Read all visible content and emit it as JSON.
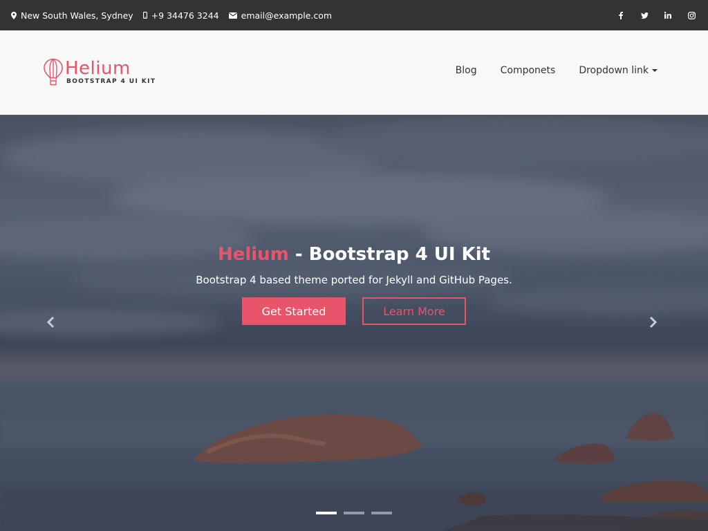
{
  "topbar": {
    "location": "New South Wales, Sydney",
    "phone": "+9 34476 3244",
    "email": "email@example.com",
    "social": [
      "facebook-icon",
      "twitter-icon",
      "linkedin-icon",
      "instagram-icon"
    ]
  },
  "brand": {
    "name": "Helium",
    "tagline": "BOOTSTRAP 4 UI KIT",
    "color": "#e8556a"
  },
  "nav": {
    "items": [
      {
        "label": "Blog"
      },
      {
        "label": "Componets"
      },
      {
        "label": "Dropdown link"
      }
    ]
  },
  "hero": {
    "title_accent": "Helium",
    "title_rest": " - Bootstrap 4 UI Kit",
    "subtitle": "Bootstrap 4 based theme ported for Jekyll and GitHub Pages.",
    "primary_button": "Get Started",
    "secondary_button": "Learn More",
    "slides": 3,
    "active_slide": 1
  },
  "colors": {
    "accent": "#e8556a",
    "topbar_bg": "#333333",
    "navbar_bg": "#f8f8f8"
  }
}
